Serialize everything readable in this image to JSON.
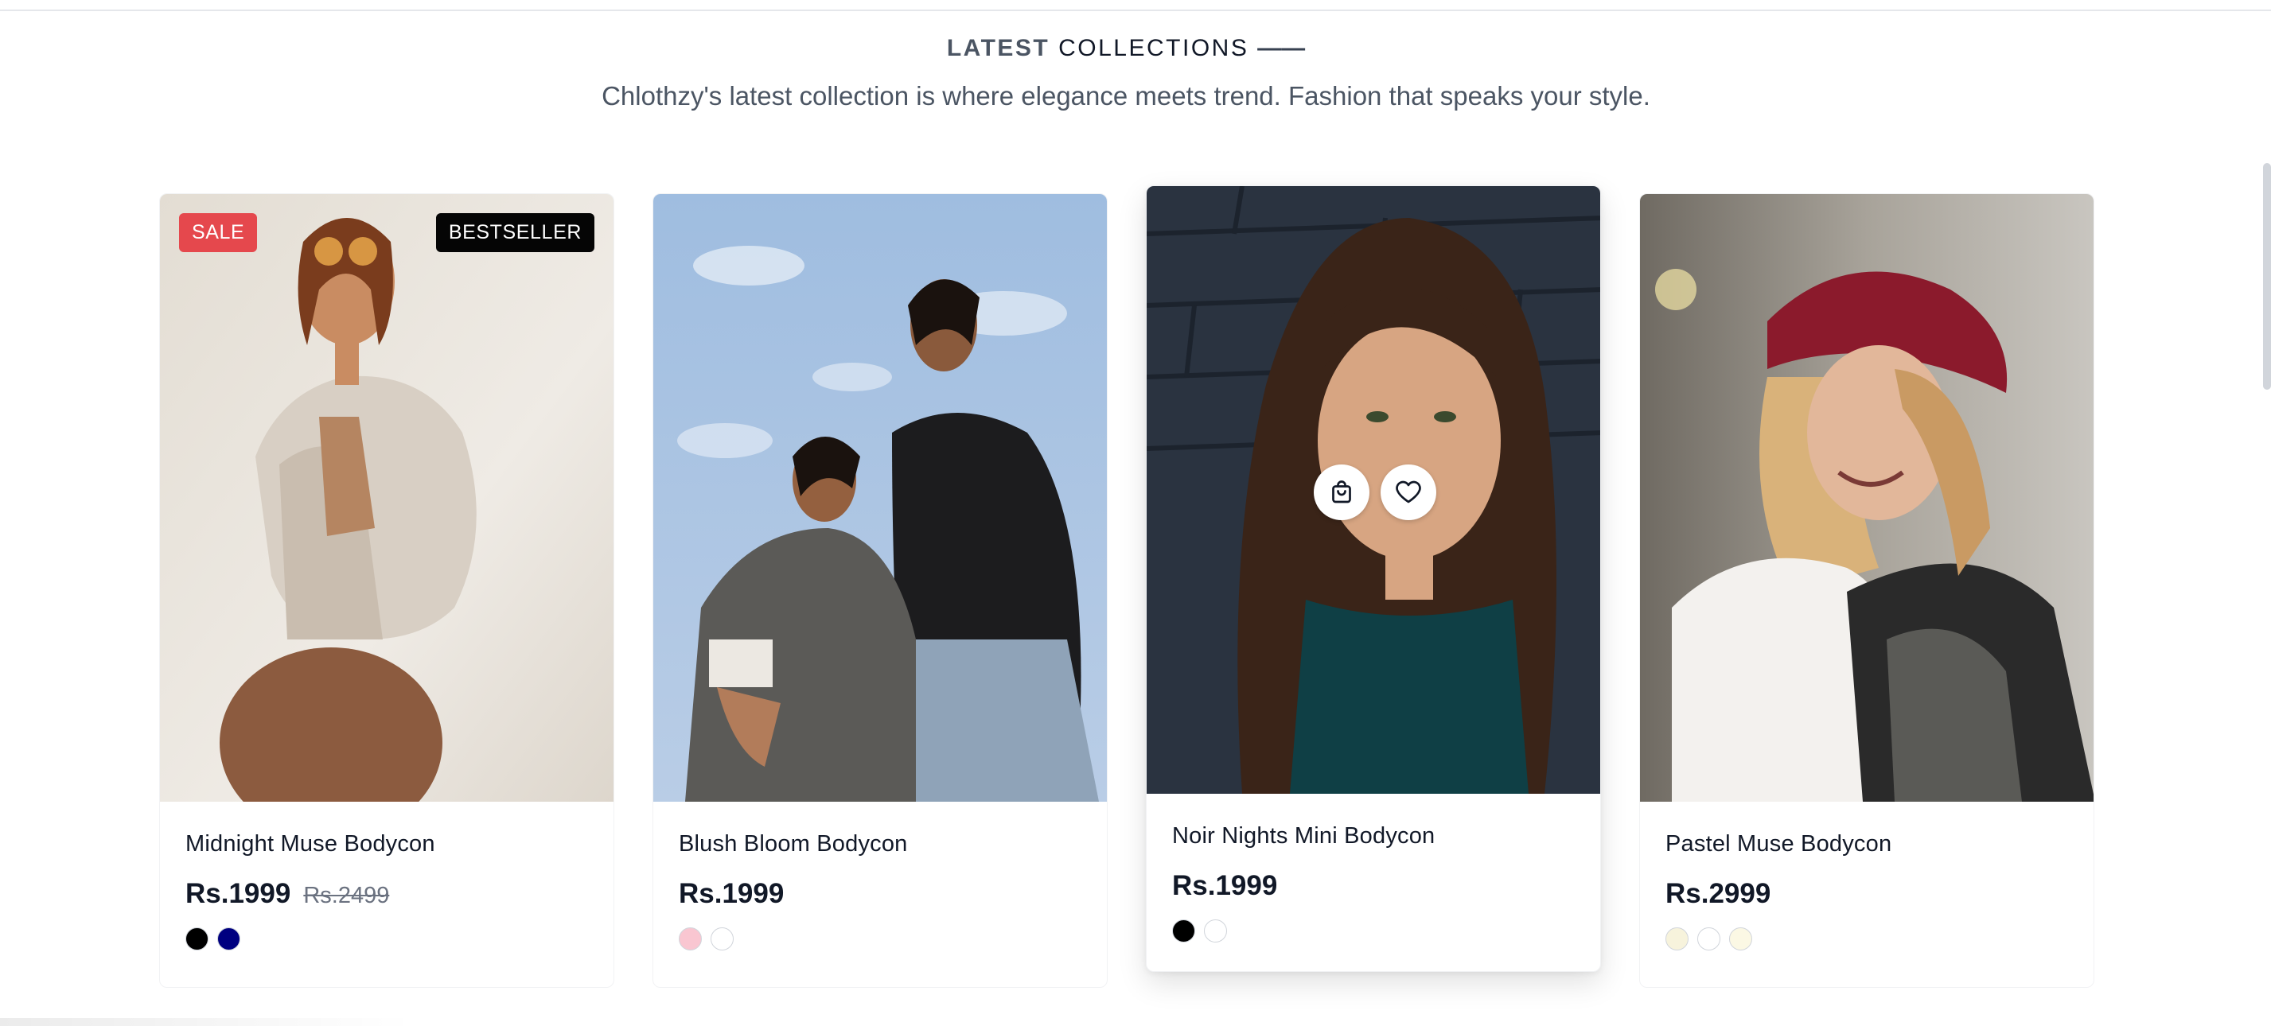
{
  "section": {
    "title_light": "LATEST",
    "title_bold": "COLLECTIONS",
    "title_dash": "——",
    "subtitle": "Chlothzy's latest collection is where elegance meets trend. Fashion that speaks your style."
  },
  "products": [
    {
      "name": "Midnight Muse Bodycon",
      "price": "Rs.1999",
      "old_price": "Rs.2499",
      "badges": {
        "sale": "SALE",
        "bestseller": "BESTSELLER"
      },
      "colors": [
        "#000000",
        "#000080"
      ]
    },
    {
      "name": "Blush Bloom Bodycon",
      "price": "Rs.1999",
      "colors": [
        "#f9c6d1",
        "#ffffff"
      ]
    },
    {
      "name": "Noir Nights Mini Bodycon",
      "price": "Rs.1999",
      "colors": [
        "#000000",
        "#ffffff"
      ],
      "hover_actions": [
        "shopping-bag-icon",
        "heart-icon"
      ]
    },
    {
      "name": "Pastel Muse Bodycon",
      "price": "Rs.2999",
      "colors": [
        "#f7f3dc",
        "#ffffff",
        "#fbf8e4"
      ]
    }
  ]
}
